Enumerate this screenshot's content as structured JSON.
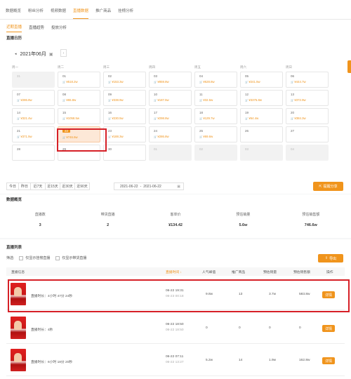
{
  "nav": {
    "tabs": [
      "数据概览",
      "粉丝分析",
      "视频数据",
      "直播数据",
      "推广商品",
      "挂榜分析"
    ],
    "active": 3
  },
  "subnav": {
    "tabs": [
      "近期直播",
      "直播趋势",
      "投放分析"
    ],
    "active": 0
  },
  "calendar": {
    "section_title": "直播日历",
    "month": "2021年06月",
    "weekdays": [
      "周一",
      "周二",
      "周三",
      "周四",
      "周五",
      "周六",
      "周日"
    ],
    "weeks": [
      [
        {
          "d": "31",
          "v": "",
          "g": true
        },
        {
          "d": "01",
          "v": "¥518.2w"
        },
        {
          "d": "02",
          "v": "¥153.3w"
        },
        {
          "d": "03",
          "v": "¥859.8w"
        },
        {
          "d": "04",
          "v": "¥628.8w"
        },
        {
          "d": "05",
          "v": "¥241.5w"
        },
        {
          "d": "06",
          "v": "¥444.7w"
        }
      ],
      [
        {
          "d": "07",
          "v": "¥286.8w"
        },
        {
          "d": "08",
          "v": "¥65.8w"
        },
        {
          "d": "09",
          "v": "¥338.9w"
        },
        {
          "d": "10",
          "v": "¥187.5w"
        },
        {
          "d": "11",
          "v": "¥32.5w"
        },
        {
          "d": "12",
          "v": "¥3375.8w"
        },
        {
          "d": "13",
          "v": "¥372.9w"
        }
      ],
      [
        {
          "d": "14",
          "v": "¥321.4w"
        },
        {
          "d": "15",
          "v": "¥1058.5w"
        },
        {
          "d": "16",
          "v": "¥230.5w"
        },
        {
          "d": "17",
          "v": "¥298.8w"
        },
        {
          "d": "18",
          "v": "¥129.7w"
        },
        {
          "d": "19",
          "v": "¥64.4w"
        },
        {
          "d": "20",
          "v": "¥384.3w"
        }
      ],
      [
        {
          "d": "21",
          "v": "¥371.5w"
        },
        {
          "d": "22",
          "v": "¥746.6w",
          "sel": true
        },
        {
          "d": "23",
          "v": "¥188.3w"
        },
        {
          "d": "24",
          "v": "¥286.8w"
        },
        {
          "d": "25",
          "v": "¥69.6w"
        },
        {
          "d": "26",
          "v": ""
        },
        {
          "d": "27",
          "v": ""
        }
      ],
      [
        {
          "d": "28",
          "v": ""
        },
        {
          "d": "29",
          "v": ""
        },
        {
          "d": "30",
          "v": ""
        },
        {
          "d": "01",
          "v": "",
          "g": true
        },
        {
          "d": "02",
          "v": "",
          "g": true
        },
        {
          "d": "03",
          "v": "",
          "g": true
        },
        {
          "d": "04",
          "v": "",
          "g": true
        }
      ]
    ]
  },
  "filter": {
    "chips": [
      "今日",
      "昨日",
      "近7天",
      "近15天",
      "近30天",
      "近90天"
    ],
    "date_from": "2021-06-22",
    "date_sep": "-",
    "date_to": "2021-06-22",
    "export_label": "提醒分享"
  },
  "overview": {
    "title": "数据概览",
    "items": [
      {
        "label": "直播数",
        "value": "3"
      },
      {
        "label": "带货直播",
        "value": "2"
      },
      {
        "label": "客单价",
        "value": "¥134.42"
      },
      {
        "label": "预估销量",
        "value": "5.6w"
      },
      {
        "label": "预估销售额",
        "value": "746.6w"
      }
    ]
  },
  "live_list": {
    "title": "直播列表",
    "filter_label": "筛选:",
    "option1": "仅显示挂榜直播",
    "option2": "仅显示带货直播",
    "export_label": "导出",
    "headers": [
      "直播信息",
      "直播时间 ↓",
      "人气峰值",
      "推广商品",
      "预估销量",
      "预估销售额",
      "操作"
    ],
    "rows": [
      {
        "duration": "直播时长：4小时 47分 24秒",
        "start": "06-22 19:31",
        "end": "06-23 00:18",
        "peak": "9.8w",
        "goods": "13",
        "sales": "3.7w",
        "revenue": "583.8w",
        "action": "详情"
      },
      {
        "duration": "直播时长：4秒",
        "start": "06-22 18:50",
        "end": "06-22 18:50",
        "peak": "0",
        "goods": "0",
        "sales": "0",
        "revenue": "0",
        "action": "详情"
      },
      {
        "duration": "直播时长：6小时 18分 20秒",
        "start": "06-22 07:11",
        "end": "06-22 13:27",
        "peak": "5.2w",
        "goods": "14",
        "sales": "1.9w",
        "revenue": "162.8w",
        "action": "详情"
      }
    ]
  }
}
